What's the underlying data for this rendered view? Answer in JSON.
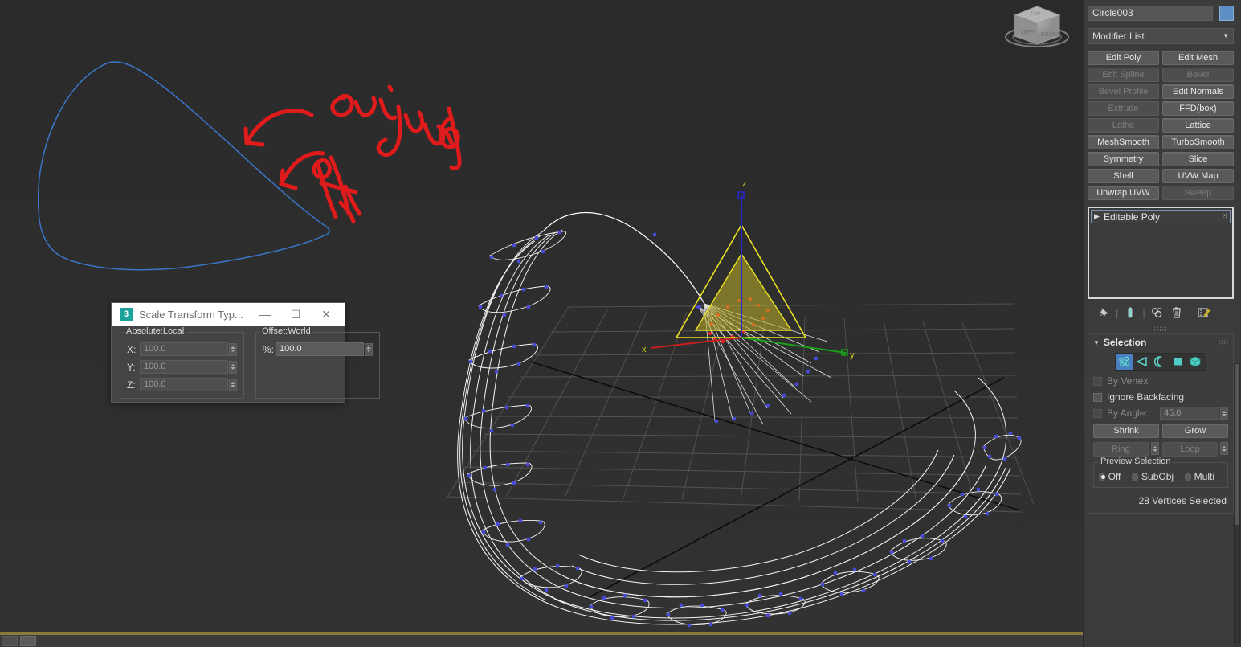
{
  "app": {
    "viewport_label": ""
  },
  "viewport": {
    "viewcube": {
      "name": "view-cube",
      "faces": [
        "TOP",
        "FRONT",
        "LEFT"
      ]
    },
    "axis_labels": {
      "x": "x",
      "y": "y",
      "z": "z"
    },
    "annotation": {
      "line1": "original",
      "line2": "Path",
      "color": "#e01b1b"
    },
    "colors": {
      "background": "#252525",
      "spline": "#3a76c8",
      "wireframe": "#ffffff",
      "vertex": "#4a4ad8",
      "gizmo": "#e8e120",
      "axis_x": "#d02020",
      "axis_y": "#18a018",
      "axis_z": "#2020c8",
      "grid": "#6a6a6a",
      "border_active": "#8a7a3c"
    }
  },
  "command_panel": {
    "object_name": "Circle003",
    "object_color": "#5c8fc4",
    "modifier_list_label": "Modifier List",
    "modifier_buttons": [
      {
        "label": "Edit Poly",
        "enabled": true
      },
      {
        "label": "Edit Mesh",
        "enabled": true
      },
      {
        "label": "Edit Spline",
        "enabled": false
      },
      {
        "label": "Bevel",
        "enabled": false
      },
      {
        "label": "Bevel Profile",
        "enabled": false
      },
      {
        "label": "Edit Normals",
        "enabled": true
      },
      {
        "label": "Extrude",
        "enabled": false
      },
      {
        "label": "FFD(box)",
        "enabled": true
      },
      {
        "label": "Lathe",
        "enabled": false
      },
      {
        "label": "Lattice",
        "enabled": true
      },
      {
        "label": "MeshSmooth",
        "enabled": true
      },
      {
        "label": "TurboSmooth",
        "enabled": true
      },
      {
        "label": "Symmetry",
        "enabled": true
      },
      {
        "label": "Slice",
        "enabled": true
      },
      {
        "label": "Shell",
        "enabled": true
      },
      {
        "label": "UVW Map",
        "enabled": true
      },
      {
        "label": "Unwrap UVW",
        "enabled": true
      },
      {
        "label": "Sweep",
        "enabled": false
      }
    ],
    "stack": {
      "items": [
        {
          "label": "Editable Poly",
          "selected": true
        }
      ]
    },
    "stack_tools": [
      {
        "name": "pin-stack-icon",
        "glyph": "📌"
      },
      {
        "name": "show-end-result-icon",
        "glyph": "🧪"
      },
      {
        "name": "make-unique-icon",
        "glyph": "⚭"
      },
      {
        "name": "remove-modifier-icon",
        "glyph": "🗑"
      },
      {
        "name": "configure-sets-icon",
        "glyph": "✎"
      }
    ],
    "selection": {
      "title": "Selection",
      "sub_object_modes": [
        {
          "name": "vertex",
          "active": true
        },
        {
          "name": "edge",
          "active": false
        },
        {
          "name": "border",
          "active": false
        },
        {
          "name": "polygon",
          "active": false
        },
        {
          "name": "element",
          "active": false
        }
      ],
      "by_vertex": {
        "label": "By Vertex",
        "checked": false,
        "enabled": false
      },
      "ignore_backfacing": {
        "label": "Ignore Backfacing",
        "checked": false,
        "enabled": true
      },
      "by_angle": {
        "label": "By Angle:",
        "value": "45.0",
        "checked": false,
        "enabled": false
      },
      "shrink": {
        "label": "Shrink",
        "enabled": true
      },
      "grow": {
        "label": "Grow",
        "enabled": true
      },
      "ring": {
        "label": "Ring",
        "enabled": false
      },
      "loop": {
        "label": "Loop",
        "enabled": false
      },
      "preview_selection": {
        "title": "Preview Selection",
        "options": [
          {
            "label": "Off",
            "selected": true
          },
          {
            "label": "SubObj",
            "selected": false
          },
          {
            "label": "Multi",
            "selected": false
          }
        ]
      },
      "status": "28 Vertices Selected"
    }
  },
  "scale_dialog": {
    "badge": "3",
    "title": "Scale Transform Typ...",
    "window_buttons": {
      "minimize": "—",
      "maximize": "☐",
      "close": "✕"
    },
    "absolute": {
      "title": "Absolute:Local",
      "fields": [
        {
          "label": "X:",
          "value": "100.0",
          "enabled": false
        },
        {
          "label": "Y:",
          "value": "100.0",
          "enabled": false
        },
        {
          "label": "Z:",
          "value": "100.0",
          "enabled": false
        }
      ]
    },
    "offset": {
      "title": "Offset:World",
      "fields": [
        {
          "label": "%:",
          "value": "100.0",
          "enabled": true
        }
      ]
    }
  }
}
